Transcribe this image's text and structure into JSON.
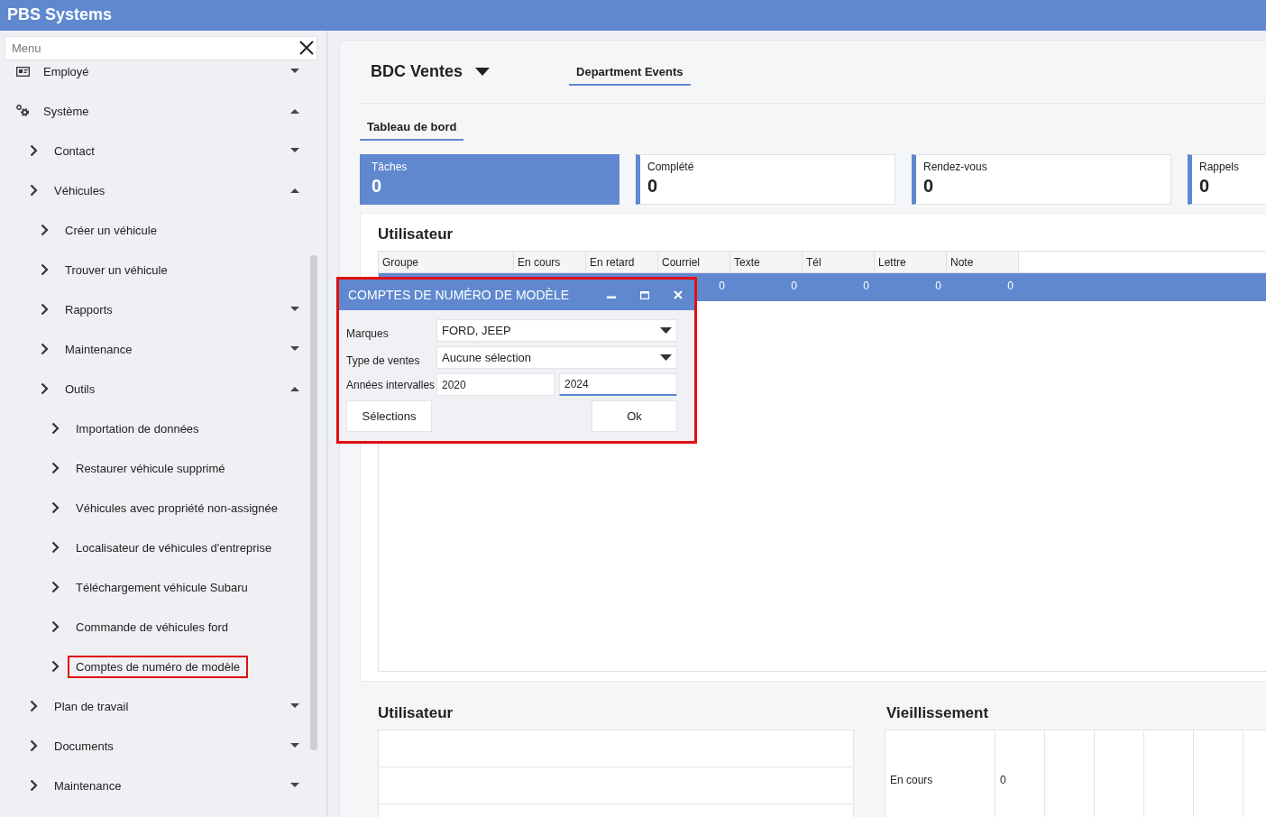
{
  "app": {
    "title": "PBS Systems"
  },
  "sidebar": {
    "search": {
      "placeholder": "Menu"
    },
    "items": [
      {
        "label": "Employé",
        "expanded": false
      },
      {
        "label": "Système",
        "expanded": true,
        "children": [
          {
            "label": "Contact",
            "expanded": false
          },
          {
            "label": "Véhicules",
            "expanded": true,
            "children": [
              {
                "label": "Créer un véhicule"
              },
              {
                "label": "Trouver un véhicule"
              },
              {
                "label": "Rapports",
                "expanded": false
              },
              {
                "label": "Maintenance",
                "expanded": false
              },
              {
                "label": "Outils",
                "expanded": true,
                "children": [
                  {
                    "label": "Importation de données",
                    "highlighted": false
                  },
                  {
                    "label": "Restaurer véhicule supprimé",
                    "highlighted": false
                  },
                  {
                    "label": "Véhicules avec propriété non-assignée",
                    "highlighted": false
                  },
                  {
                    "label": "Localisateur de véhicules d'entreprise",
                    "highlighted": false
                  },
                  {
                    "label": "Téléchargement véhicule Subaru",
                    "highlighted": false
                  },
                  {
                    "label": "Commande de véhicules ford",
                    "highlighted": false
                  },
                  {
                    "label": "Comptes de numéro de modèle",
                    "highlighted": true
                  }
                ]
              }
            ]
          },
          {
            "label": "Plan de travail",
            "expanded": false
          },
          {
            "label": "Documents",
            "expanded": false
          },
          {
            "label": "Maintenance",
            "expanded": false
          }
        ]
      }
    ]
  },
  "main": {
    "title": "BDC Ventes",
    "top_tabs": [
      {
        "label": "Department Events",
        "selected": true
      }
    ],
    "tabs": [
      {
        "label": "Tableau de bord",
        "selected": true
      }
    ],
    "stats": [
      {
        "label": "Tâches",
        "value": "0",
        "selected": true
      },
      {
        "label": "Complété",
        "value": "0",
        "selected": false
      },
      {
        "label": "Rendez-vous",
        "value": "0",
        "selected": false
      },
      {
        "label": "Rappels",
        "value": "0",
        "selected": false
      }
    ],
    "user_grid": {
      "title": "Utilisateur",
      "columns": [
        "Groupe",
        "En cours",
        "En retard",
        "Courriel",
        "Texte",
        "Tél",
        "Lettre",
        "Note"
      ],
      "rows": [
        {
          "selected": true,
          "values": [
            "0",
            "0",
            "0",
            "0",
            "0"
          ]
        }
      ]
    },
    "user_panel": {
      "title": "Utilisateur"
    },
    "aging": {
      "title": "Vieillissement",
      "rows": [
        {
          "label": "En cours",
          "value": "0"
        }
      ]
    }
  },
  "dialog": {
    "title": "COMPTES DE NUMÉRO DE MODÈLE",
    "highlighted": true,
    "fields": [
      {
        "kind": "dropdown",
        "label": "Marques",
        "value": "FORD, JEEP"
      },
      {
        "kind": "dropdown",
        "label": "Type de ventes",
        "value": "Aucune sélection"
      },
      {
        "kind": "range",
        "label": "Années intervalles",
        "from": {
          "value": "2020",
          "focused": false
        },
        "to": {
          "value": "2024",
          "focused": true
        }
      }
    ],
    "buttons": [
      "Sélections",
      "Ok"
    ]
  }
}
